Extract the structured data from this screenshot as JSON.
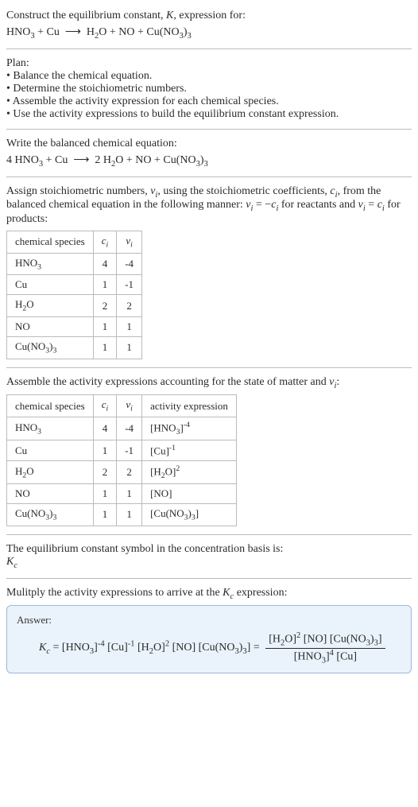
{
  "intro": {
    "line1": "Construct the equilibrium constant, K, expression for:",
    "reaction": "HNO₃ + Cu ⟶ H₂O + NO + Cu(NO₃)₃"
  },
  "plan": {
    "heading": "Plan:",
    "items": [
      "Balance the chemical equation.",
      "Determine the stoichiometric numbers.",
      "Assemble the activity expression for each chemical species.",
      "Use the activity expressions to build the equilibrium constant expression."
    ]
  },
  "balanced": {
    "heading": "Write the balanced chemical equation:",
    "reaction": "4 HNO₃ + Cu ⟶ 2 H₂O + NO + Cu(NO₃)₃"
  },
  "stoich": {
    "intro_part1": "Assign stoichiometric numbers, ",
    "intro_nu": "νᵢ",
    "intro_part2": ", using the stoichiometric coefficients, ",
    "intro_c": "cᵢ",
    "intro_part3": ", from the balanced chemical equation in the following manner: νᵢ = −cᵢ for reactants and νᵢ = cᵢ for products:",
    "headers": [
      "chemical species",
      "cᵢ",
      "νᵢ"
    ],
    "rows": [
      {
        "species": "HNO₃",
        "c": "4",
        "nu": "-4"
      },
      {
        "species": "Cu",
        "c": "1",
        "nu": "-1"
      },
      {
        "species": "H₂O",
        "c": "2",
        "nu": "2"
      },
      {
        "species": "NO",
        "c": "1",
        "nu": "1"
      },
      {
        "species": "Cu(NO₃)₃",
        "c": "1",
        "nu": "1"
      }
    ]
  },
  "activity": {
    "intro": "Assemble the activity expressions accounting for the state of matter and νᵢ:",
    "headers": [
      "chemical species",
      "cᵢ",
      "νᵢ",
      "activity expression"
    ],
    "rows": [
      {
        "species": "HNO₃",
        "c": "4",
        "nu": "-4",
        "expr": "[HNO₃]⁻⁴"
      },
      {
        "species": "Cu",
        "c": "1",
        "nu": "-1",
        "expr": "[Cu]⁻¹"
      },
      {
        "species": "H₂O",
        "c": "2",
        "nu": "2",
        "expr": "[H₂O]²"
      },
      {
        "species": "NO",
        "c": "1",
        "nu": "1",
        "expr": "[NO]"
      },
      {
        "species": "Cu(NO₃)₃",
        "c": "1",
        "nu": "1",
        "expr": "[Cu(NO₃)₃]"
      }
    ]
  },
  "basis": {
    "line": "The equilibrium constant symbol in the concentration basis is:",
    "symbol": "K_c"
  },
  "multiply": {
    "line": "Mulitply the activity expressions to arrive at the K_c expression:"
  },
  "answer": {
    "label": "Answer:",
    "lhs": "K_c = [HNO₃]⁻⁴ [Cu]⁻¹ [H₂O]² [NO] [Cu(NO₃)₃] =",
    "num": "[H₂O]² [NO] [Cu(NO₃)₃]",
    "den": "[HNO₃]⁴ [Cu]"
  }
}
